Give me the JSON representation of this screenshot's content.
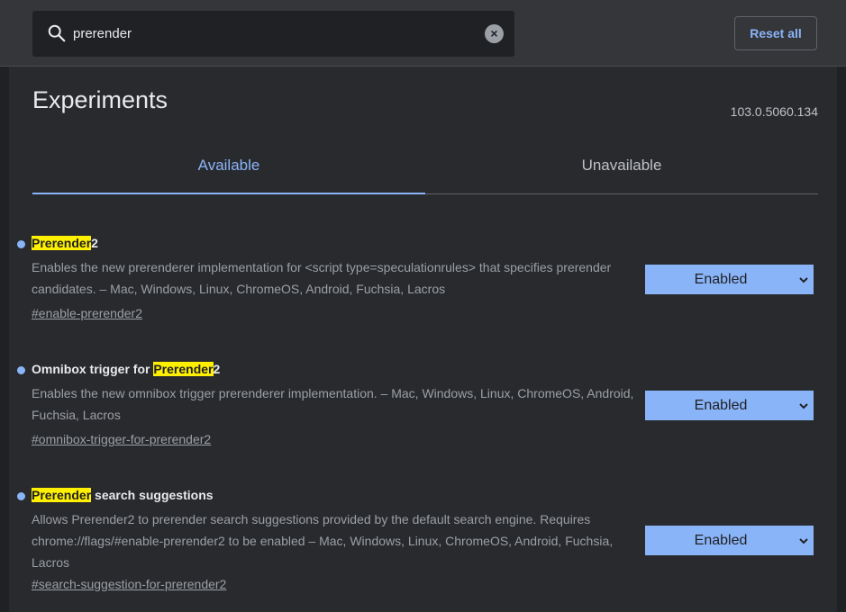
{
  "search": {
    "value": "prerender",
    "search_icon": "search-icon",
    "clear_icon": "clear-icon"
  },
  "header": {
    "reset_label": "Reset all"
  },
  "page": {
    "title": "Experiments",
    "version": "103.0.5060.134"
  },
  "tabs": [
    {
      "label": "Available",
      "active": true
    },
    {
      "label": "Unavailable",
      "active": false
    }
  ],
  "experiments": [
    {
      "title_pre": "",
      "title_highlight": "Prerender",
      "title_post": "2",
      "description": "Enables the new prerenderer implementation for <script type=speculationrules> that specifies prerender candidates. – Mac, Windows, Linux, ChromeOS, Android, Fuchsia, Lacros",
      "link": "#enable-prerender2",
      "state": "Enabled"
    },
    {
      "title_pre": "Omnibox trigger for ",
      "title_highlight": "Prerender",
      "title_post": "2",
      "description": "Enables the new omnibox trigger prerenderer implementation. – Mac, Windows, Linux, ChromeOS, Android, Fuchsia, Lacros",
      "link": "#omnibox-trigger-for-prerender2",
      "state": "Enabled"
    },
    {
      "title_pre": "",
      "title_highlight": "Prerender",
      "title_post": " search suggestions",
      "description": "Allows Prerender2 to prerender search suggestions provided by the default search engine. Requires chrome://flags/#enable-prerender2 to be enabled – Mac, Windows, Linux, ChromeOS, Android, Fuchsia, Lacros",
      "link": "#search-suggestion-for-prerender2",
      "state": "Enabled"
    }
  ],
  "colors": {
    "accent": "#8ab4f8",
    "highlight": "#fff000",
    "background": "#202124",
    "panel": "#292a2d"
  }
}
